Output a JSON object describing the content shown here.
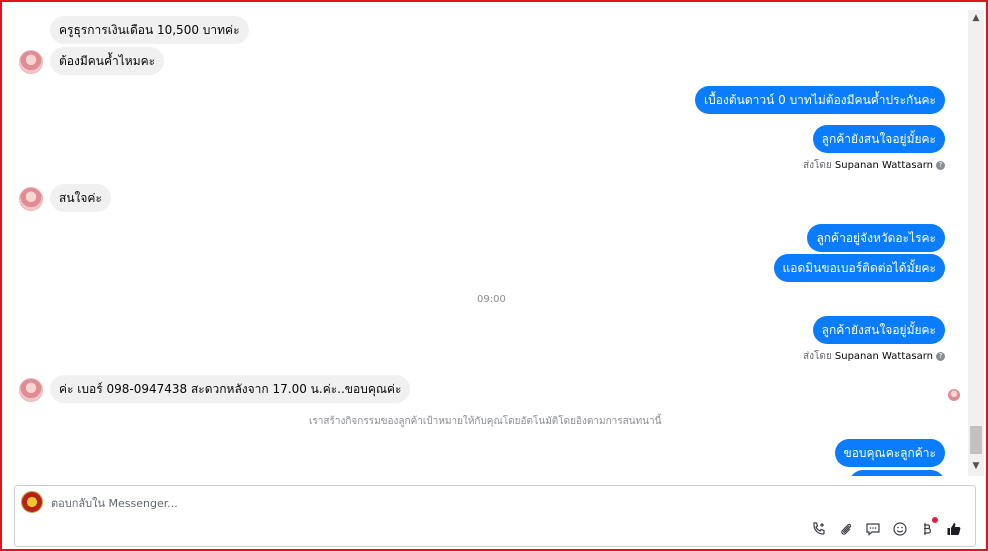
{
  "conversation": {
    "messages": [
      {
        "text": "ครูธุรการเงินเดือน 10,500 บาทค่ะ"
      },
      {
        "text": "ต้องมีคนค้ำไหมคะ"
      },
      {
        "text": "เบื้องต้นดาวน์ 0 บาทไม่ต้องมีคนค้ำประกันคะ"
      },
      {
        "text": "ลูกค้ายังสนใจอยู่มั้ยคะ"
      },
      {
        "text": "สนใจค่ะ"
      },
      {
        "text": "ลูกค้าอยู่จังหวัดอะไรคะ"
      },
      {
        "text": "แอดมินขอเบอร์ติดต่อได้มั้ยคะ"
      },
      {
        "text": "ลูกค้ายังสนใจอยู่มั้ยคะ"
      },
      {
        "text": "ค่ะ เบอร์ 098-0947438 สะดวกหลังจาก 17.00 น.ค่ะ..ขอบคุณค่ะ"
      },
      {
        "text": "ขอบคุณคะลูกค้าะ"
      }
    ],
    "sent_by_prefix": "ส่งโดย",
    "sent_by_name": "Supanan Wattasarn",
    "time_divider": "09:00",
    "system_notice": "เราสร้างกิจกรรมของลูกค้าเป้าหมายให้กับคุณโดยอัตโนมัติโดยอิงตามการสนทนานี้"
  },
  "composer": {
    "placeholder": "ตอบกลับใน Messenger..."
  },
  "icons": {
    "scroll_up": "▲",
    "scroll_down": "▼",
    "info": "?"
  },
  "colors": {
    "outgoing_bubble": "#0a7cff",
    "incoming_bubble": "#f0f0f0",
    "frame_border": "#e0141e"
  }
}
